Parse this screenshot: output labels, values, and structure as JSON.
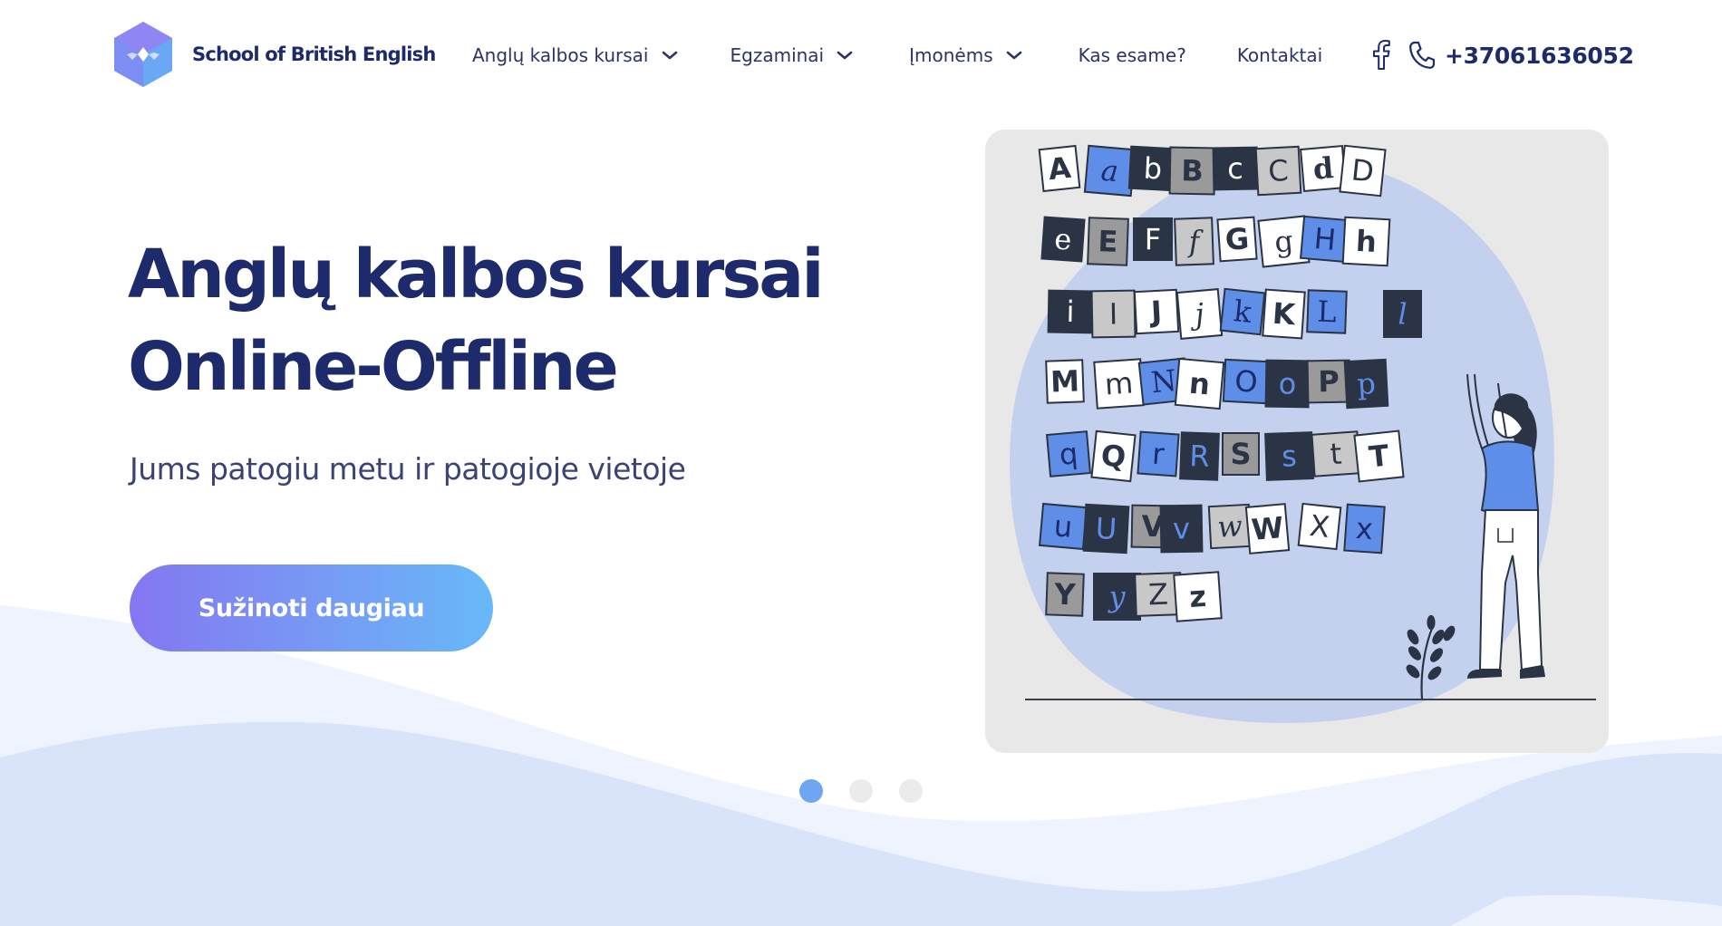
{
  "brand": {
    "name": "School of British English"
  },
  "nav": {
    "items": [
      {
        "label": "Anglų kalbos kursai",
        "has_dropdown": true
      },
      {
        "label": "Egzaminai",
        "has_dropdown": true
      },
      {
        "label": "Įmonėms",
        "has_dropdown": true
      },
      {
        "label": "Kas esame?",
        "has_dropdown": false
      },
      {
        "label": "Kontaktai",
        "has_dropdown": false
      }
    ],
    "facebook_icon": "facebook-icon",
    "phone_icon": "phone-icon",
    "phone": "+37061636052"
  },
  "hero": {
    "title_line1": "Anglų kalbos kursai",
    "title_line2": "Online-Offline",
    "subtitle": "Jums patogiu metu ir patogioje vietoje",
    "cta_label": "Sužinoti daugiau"
  },
  "illustration": {
    "icon": "alphabet-wall-illustration",
    "letters": [
      [
        "A",
        "a",
        "b",
        "B",
        "c",
        "C",
        "d",
        "D"
      ],
      [
        "e",
        "E",
        "F",
        "f",
        "G",
        "g",
        "H",
        "h"
      ],
      [
        "i",
        "I",
        "J",
        "j",
        "k",
        "K",
        "L",
        "l"
      ],
      [
        "M",
        "m",
        "N",
        "n",
        "O",
        "o",
        "P",
        "p"
      ],
      [
        "q",
        "Q",
        "r",
        "R",
        "S",
        "s",
        "t",
        "T"
      ],
      [
        "u",
        "U",
        "V",
        "v",
        "w",
        "W",
        "X",
        "x"
      ],
      [
        "Y",
        "y",
        "Z",
        "z"
      ]
    ]
  },
  "carousel": {
    "slide_count": 3,
    "active_index": 0
  },
  "colors": {
    "navy": "#1d2a6b",
    "accent_blue": "#6ea6f2",
    "cta_gradient_start": "#8477f2",
    "cta_gradient_end": "#67b9f8",
    "wave_light": "#eef3fd",
    "wave_mid": "#d8e3fb"
  }
}
